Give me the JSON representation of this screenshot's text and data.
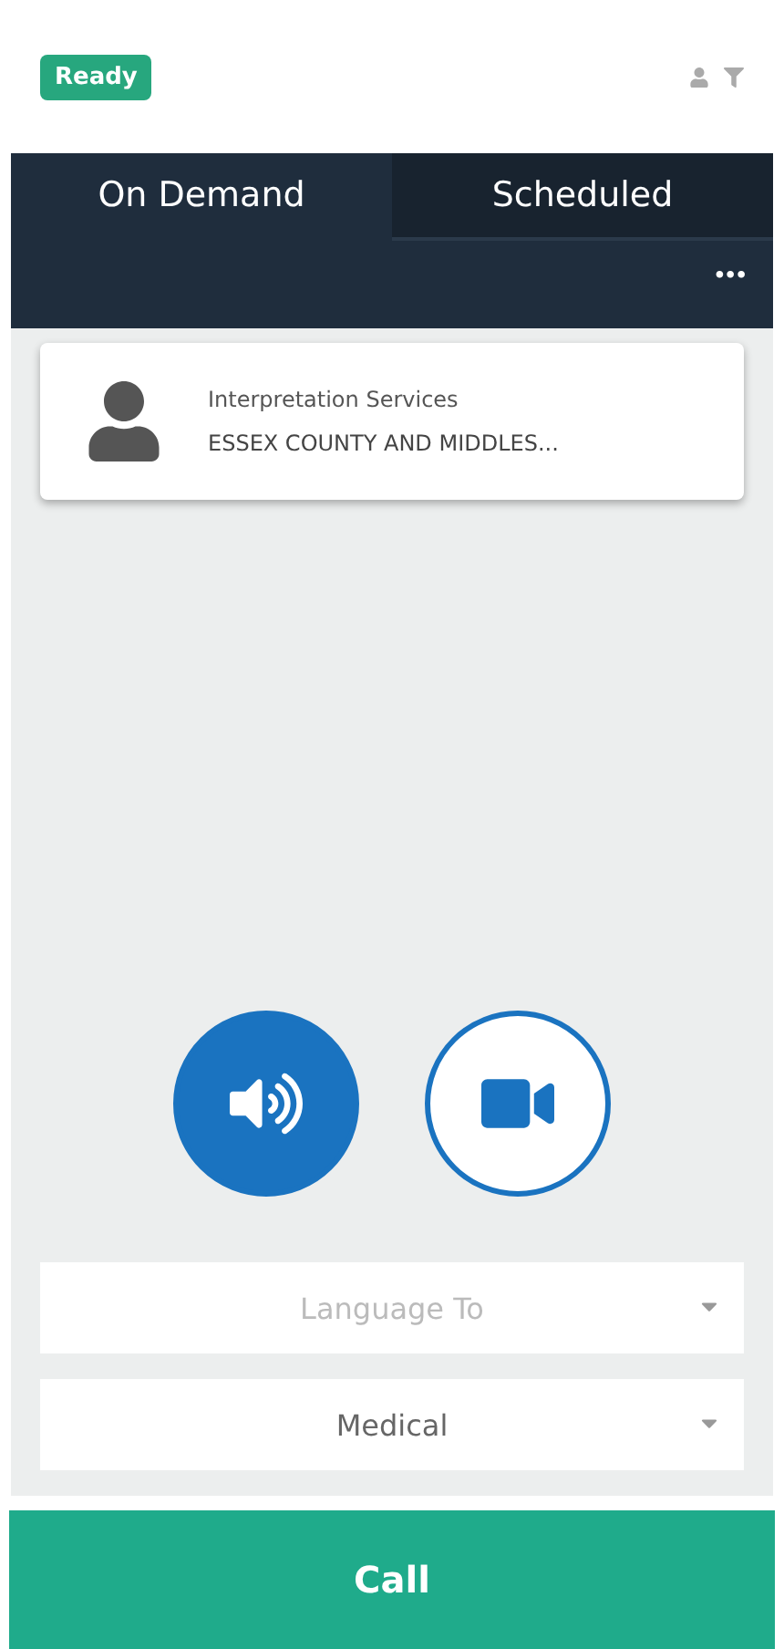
{
  "status_badge": "Ready",
  "tabs": [
    {
      "label": "On Demand",
      "selected": true
    },
    {
      "label": "Scheduled",
      "selected": false
    }
  ],
  "more_menu": "•••",
  "service_card": {
    "title": "Interpretation Services",
    "subtitle": "ESSEX COUNTY AND MIDDLES..."
  },
  "call_modes": [
    {
      "kind": "audio",
      "selected": true
    },
    {
      "kind": "video",
      "selected": false
    }
  ],
  "dropdowns": [
    {
      "placeholder": "Language To"
    },
    {
      "value": "Medical"
    }
  ],
  "call_button": "Call"
}
